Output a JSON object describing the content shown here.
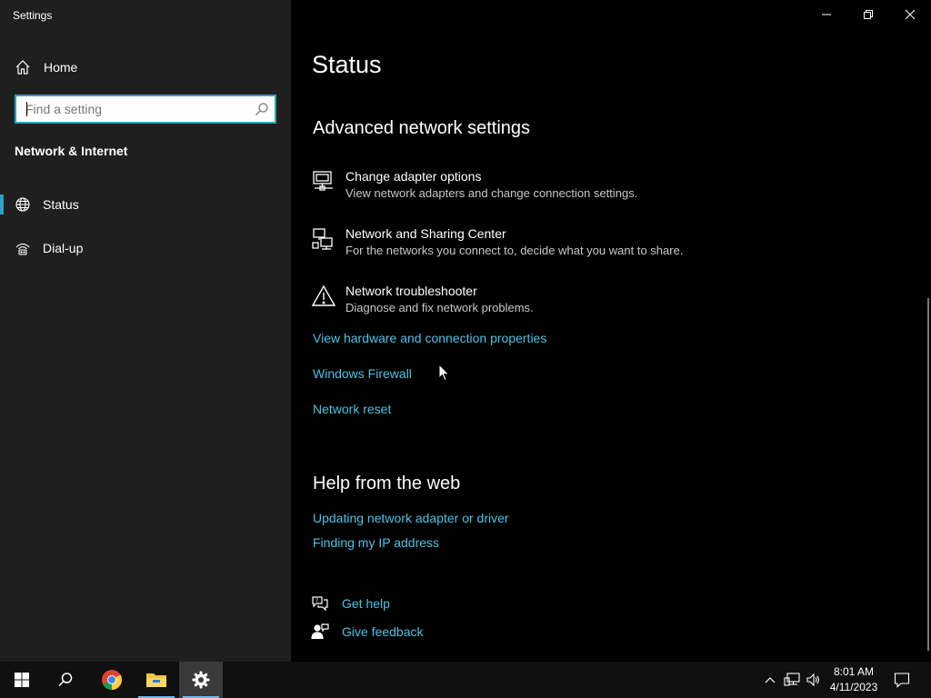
{
  "window": {
    "title": "Settings"
  },
  "sidebar": {
    "home_label": "Home",
    "search": {
      "placeholder": "Find a setting",
      "value": ""
    },
    "section_title": "Network & Internet",
    "items": [
      {
        "label": "Status",
        "icon": "globe-icon",
        "active": true
      },
      {
        "label": "Dial-up",
        "icon": "dial-up-icon",
        "active": false
      }
    ]
  },
  "main": {
    "page_title": "Status",
    "advanced": {
      "heading": "Advanced network settings",
      "options": [
        {
          "title": "Change adapter options",
          "desc": "View network adapters and change connection settings.",
          "icon": "adapter-icon"
        },
        {
          "title": "Network and Sharing Center",
          "desc": "For the networks you connect to, decide what you want to share.",
          "icon": "sharing-center-icon"
        },
        {
          "title": "Network troubleshooter",
          "desc": "Diagnose and fix network problems.",
          "icon": "warning-icon"
        }
      ],
      "links": [
        "View hardware and connection properties",
        "Windows Firewall",
        "Network reset"
      ]
    },
    "help": {
      "heading": "Help from the web",
      "links": [
        "Updating network adapter or driver",
        "Finding my IP address"
      ]
    },
    "footer": {
      "get_help": "Get help",
      "give_feedback": "Give feedback"
    }
  },
  "taskbar": {
    "time": "8:01 AM",
    "date": "4/11/2023"
  },
  "colors": {
    "accent": "#2ea3bd",
    "link": "#4cc2e4",
    "sidebar_bg": "#1f1f1f",
    "main_bg": "#000000",
    "taskbar_bg": "#101010"
  }
}
